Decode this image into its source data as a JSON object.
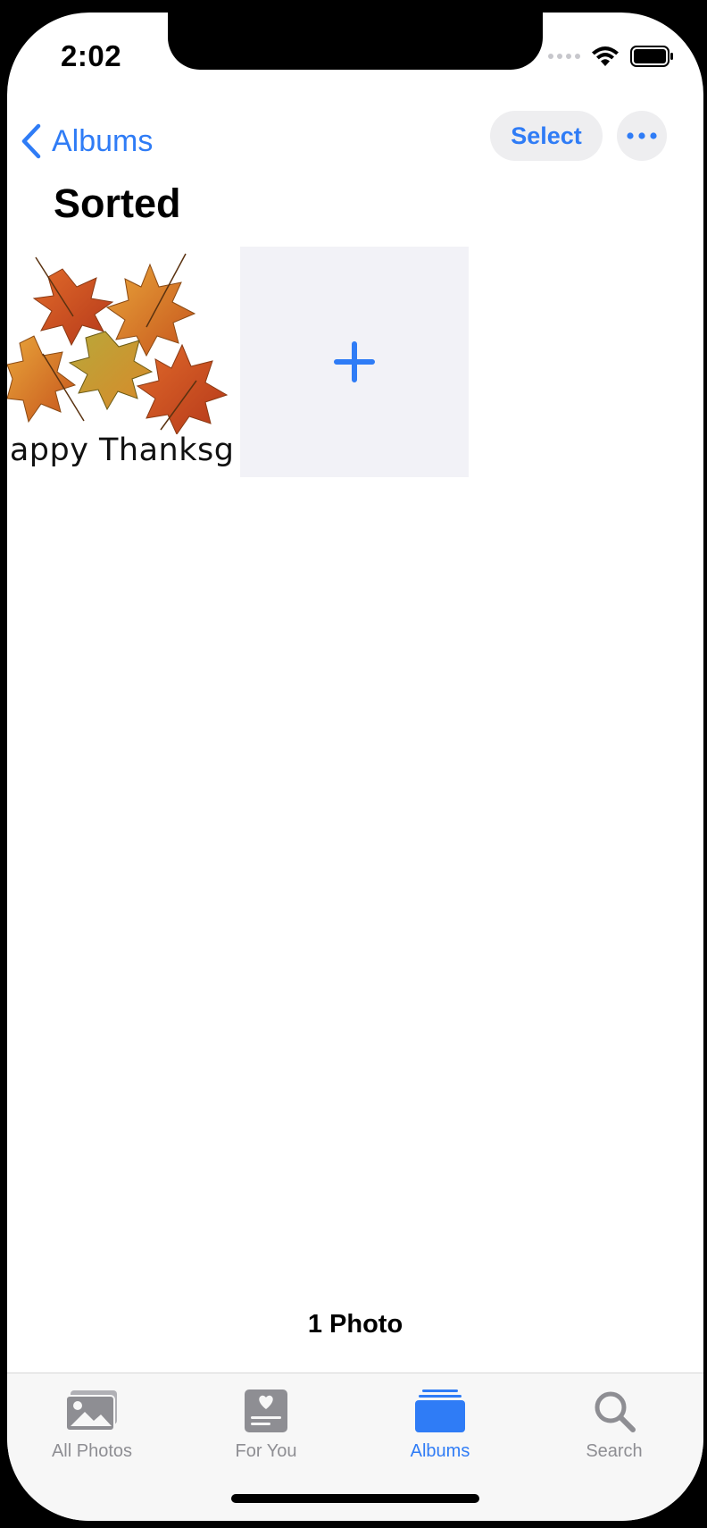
{
  "status": {
    "time": "2:02"
  },
  "nav": {
    "back_label": "Albums",
    "select_label": "Select"
  },
  "album": {
    "title": "Sorted",
    "thumb_caption": "Happy  Thanksgiving",
    "count_label": "1 Photo"
  },
  "tabs": [
    {
      "label": "All Photos",
      "icon": "photo-icon"
    },
    {
      "label": "For You",
      "icon": "for-you-icon"
    },
    {
      "label": "Albums",
      "icon": "albums-icon",
      "active": true
    },
    {
      "label": "Search",
      "icon": "search-icon"
    }
  ],
  "colors": {
    "accent": "#2f7cf6",
    "inactive": "#8e8e93"
  }
}
